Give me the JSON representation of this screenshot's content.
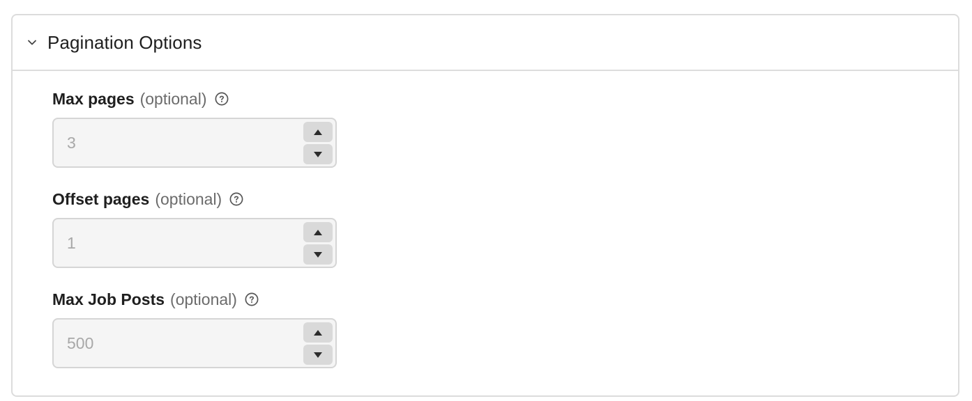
{
  "section": {
    "title": "Pagination Options",
    "expanded": true,
    "icon": "chevron-down-icon"
  },
  "fields": [
    {
      "label": "Max pages",
      "optional": "(optional)",
      "placeholder": "3",
      "icon": "help-circle-icon"
    },
    {
      "label": "Offset pages",
      "optional": "(optional)",
      "placeholder": "1",
      "icon": "help-circle-icon"
    },
    {
      "label": "Max Job Posts",
      "optional": "(optional)",
      "placeholder": "500",
      "icon": "help-circle-icon"
    }
  ],
  "colors": {
    "border": "#dcdcdc",
    "input_bg": "#f5f5f5",
    "stepper_bg": "#d9d9d9",
    "placeholder": "#a8a8a8"
  }
}
